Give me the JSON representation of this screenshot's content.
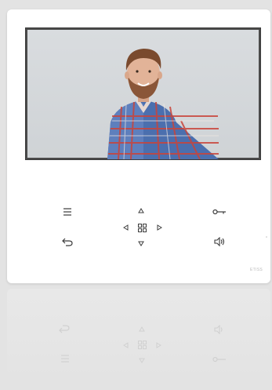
{
  "device": {
    "brand_mark": "ETISS",
    "accent_color": "#3b3b3b",
    "background_color": "#ffffff",
    "screen": {
      "content": "intercom-camera-view"
    }
  },
  "controls": {
    "menu": {
      "icon": "menu-icon"
    },
    "key": {
      "icon": "key-icon"
    },
    "up": {
      "icon": "triangle-up-icon"
    },
    "left": {
      "icon": "triangle-left-icon"
    },
    "right": {
      "icon": "triangle-right-icon"
    },
    "down": {
      "icon": "triangle-down-icon"
    },
    "ok": {
      "icon": "grid-icon"
    },
    "back": {
      "icon": "back-arrow-icon"
    },
    "volume": {
      "icon": "speaker-icon"
    }
  }
}
